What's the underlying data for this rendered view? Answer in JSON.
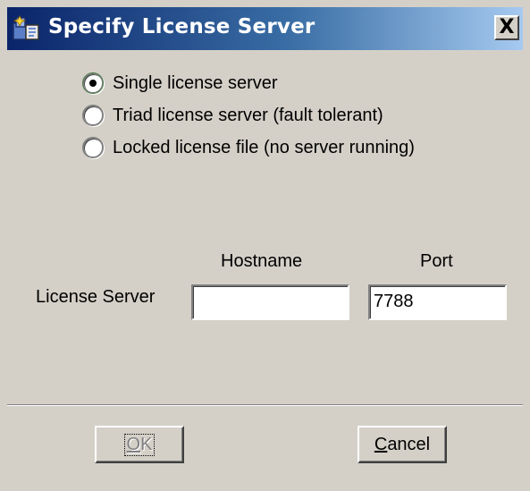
{
  "window": {
    "title": "Specify License Server",
    "close_label": "X"
  },
  "server_type": {
    "options": [
      {
        "label": "Single license server",
        "selected": true
      },
      {
        "label": "Triad license server (fault tolerant)",
        "selected": false
      },
      {
        "label": "Locked license file (no server running)",
        "selected": false
      }
    ]
  },
  "license_server": {
    "row_label": "License Server",
    "hostname_header": "Hostname",
    "port_header": "Port",
    "hostname_value": "",
    "port_value": "7788"
  },
  "buttons": {
    "ok_label": "OK",
    "cancel_label": "Cancel"
  }
}
